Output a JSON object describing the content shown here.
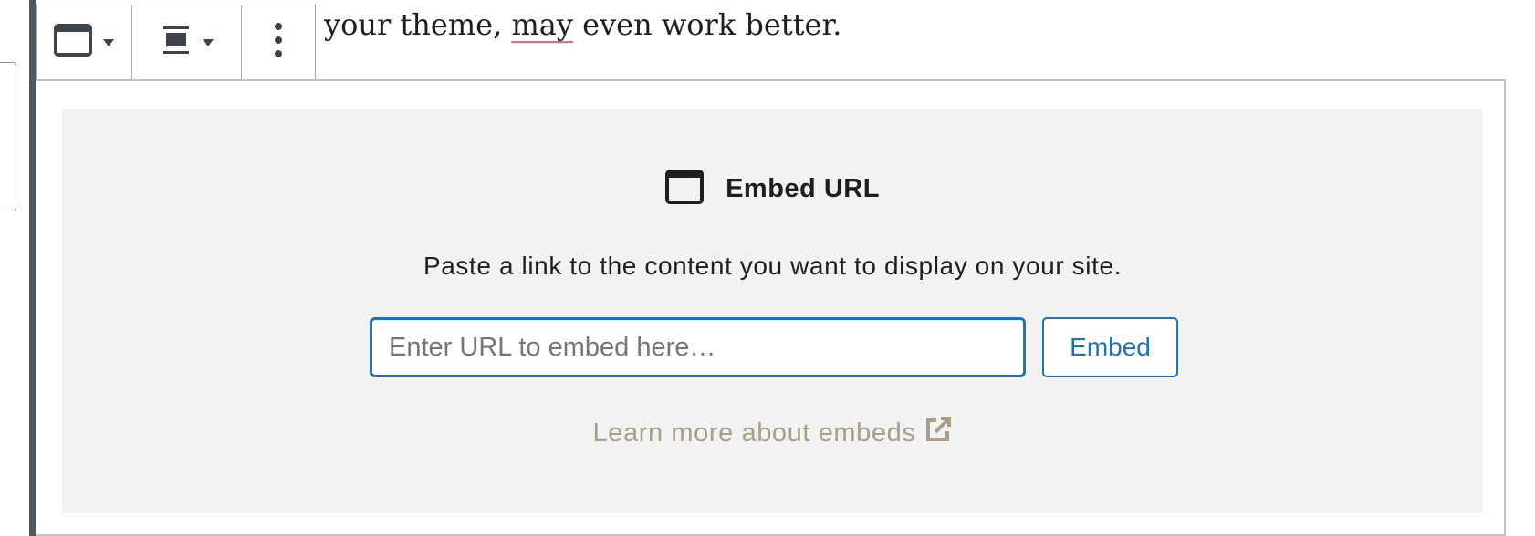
{
  "editor": {
    "paragraph_before": "your theme,",
    "misspelled_word": "may",
    "paragraph_after": "even work better."
  },
  "toolbar": {
    "items": [
      {
        "name": "block-type",
        "icon": "embed-block-icon",
        "dropdown": true
      },
      {
        "name": "alignment",
        "icon": "align-center-icon",
        "dropdown": true
      },
      {
        "name": "more-options",
        "icon": "vertical-ellipsis-icon",
        "dropdown": false
      }
    ]
  },
  "embed": {
    "title": "Embed URL",
    "instructions": "Paste a link to the content you want to display on your site.",
    "input_placeholder": "Enter URL to embed here…",
    "input_value": "",
    "button_label": "Embed",
    "learn_more": "Learn more about embeds",
    "learn_more_icon": "external-link-icon"
  },
  "colors": {
    "accent": "#2271b1",
    "placeholder_bg": "#f2f2f2",
    "link_muted": "#a89f8a",
    "spelling_underline": "#e36d73"
  }
}
